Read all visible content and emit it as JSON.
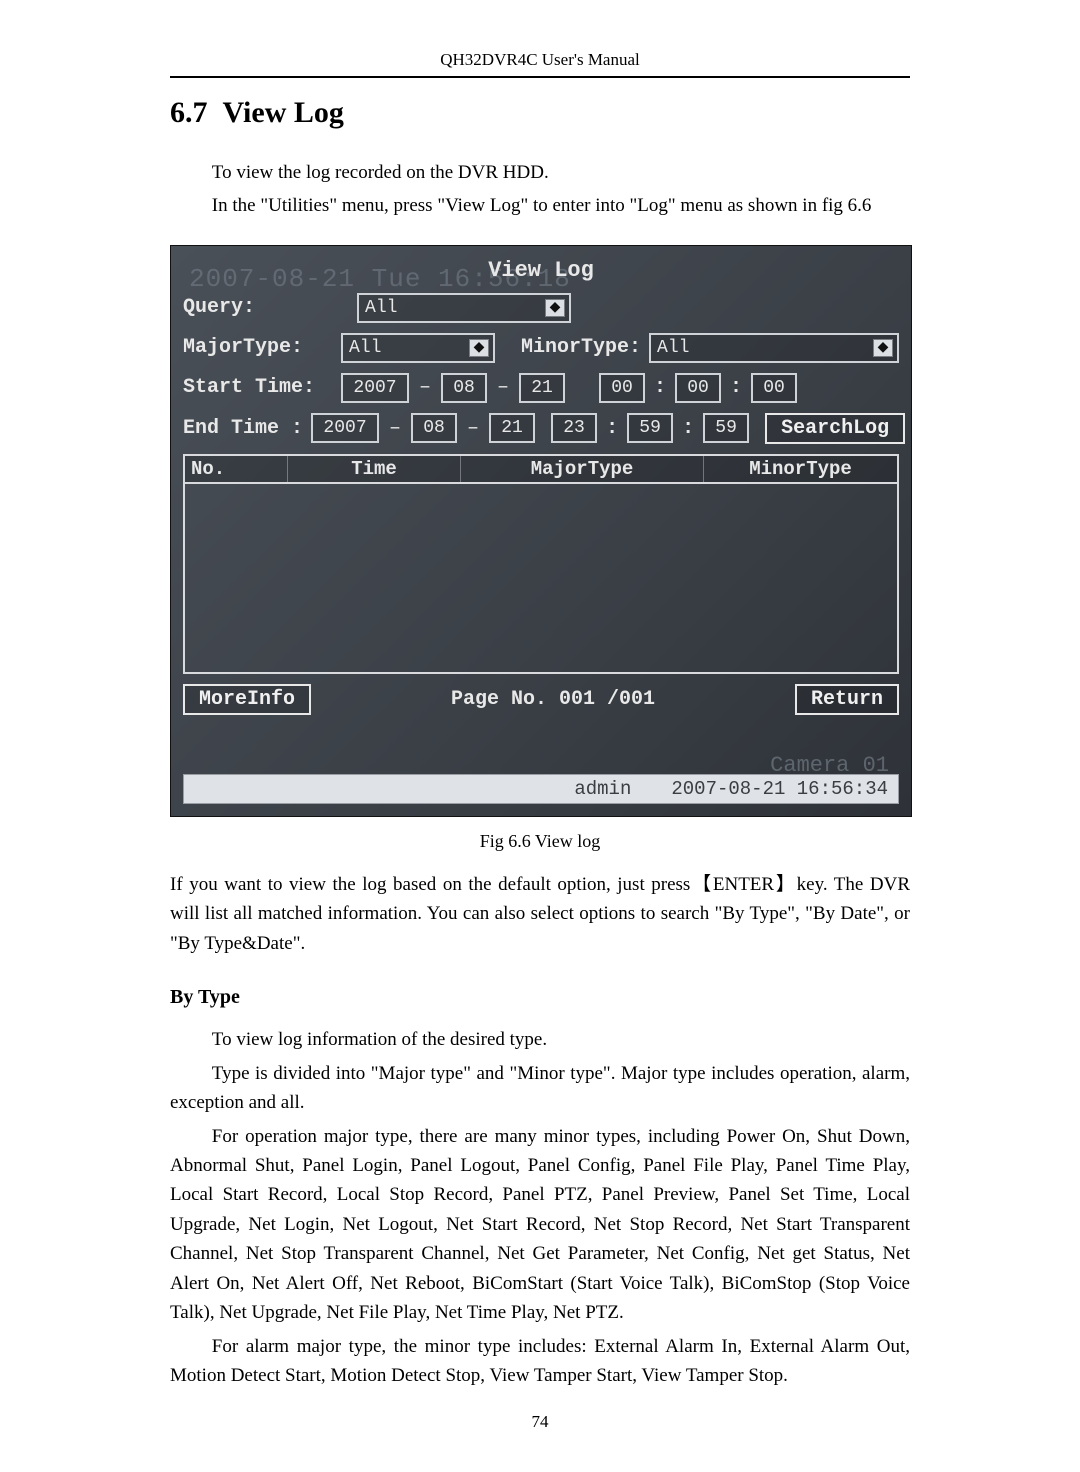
{
  "header": {
    "running": "QH32DVR4C User's Manual"
  },
  "section": {
    "number": "6.7",
    "title": "View Log"
  },
  "intro": {
    "line1": "To view the log recorded on the DVR HDD.",
    "line2": "In the \"Utilities\" menu, press \"View Log\" to enter into \"Log\" menu as shown in fig 6.6"
  },
  "dvr": {
    "ghost_timestamp": "2007-08-21 Tue 16:56:18",
    "ghost_camera": "Camera 01",
    "title": "View Log",
    "query_label": "Query:",
    "query_value": "All",
    "major_label": "MajorType:",
    "major_value": "All",
    "minor_label": "MinorType:",
    "minor_value": "All",
    "start_label": "Start Time:",
    "start_year": "2007",
    "start_month": "08",
    "start_day": "21",
    "start_h": "00",
    "start_m": "00",
    "start_s": "00",
    "end_label": "End  Time  :",
    "end_year": "2007",
    "end_month": "08",
    "end_day": "21",
    "end_h": "23",
    "end_m": "59",
    "end_s": "59",
    "search_btn": "SearchLog",
    "columns": {
      "no": "No.",
      "time": "Time",
      "major": "MajorType",
      "minor": "MinorType"
    },
    "more_btn": "MoreInfo",
    "page_text": "Page No. 001 /001",
    "return_btn": "Return",
    "status_user": "admin",
    "status_time": "2007-08-21 16:56:34"
  },
  "figcaption": "Fig 6.6 View log",
  "para_enter": "If you want to view the log based on the default option, just press【ENTER】key. The DVR will list all matched information. You can also select options to search \"By Type\", \"By Date\", or \"By Type&Date\".",
  "bytype": {
    "heading": "By Type",
    "p1": "To view log information of the desired type.",
    "p2": "Type is divided into \"Major type\" and \"Minor type\". Major type includes operation, alarm, exception and all.",
    "p3": "For operation major type, there are many minor types, including Power On, Shut Down, Abnormal Shut, Panel Login, Panel Logout, Panel Config, Panel File Play, Panel Time Play, Local Start Record, Local Stop Record, Panel PTZ, Panel Preview, Panel Set Time, Local Upgrade, Net Login, Net Logout, Net Start Record, Net Stop Record, Net Start Transparent Channel, Net Stop Transparent Channel, Net Get Parameter, Net Config, Net get Status, Net Alert On, Net Alert Off, Net Reboot, BiComStart (Start Voice Talk), BiComStop (Stop Voice Talk), Net Upgrade, Net File Play, Net Time Play, Net PTZ.",
    "p4": "For alarm major type, the minor type includes: External Alarm In, External Alarm Out, Motion Detect Start, Motion Detect Stop, View Tamper Start, View Tamper Stop."
  },
  "page_number": "74"
}
